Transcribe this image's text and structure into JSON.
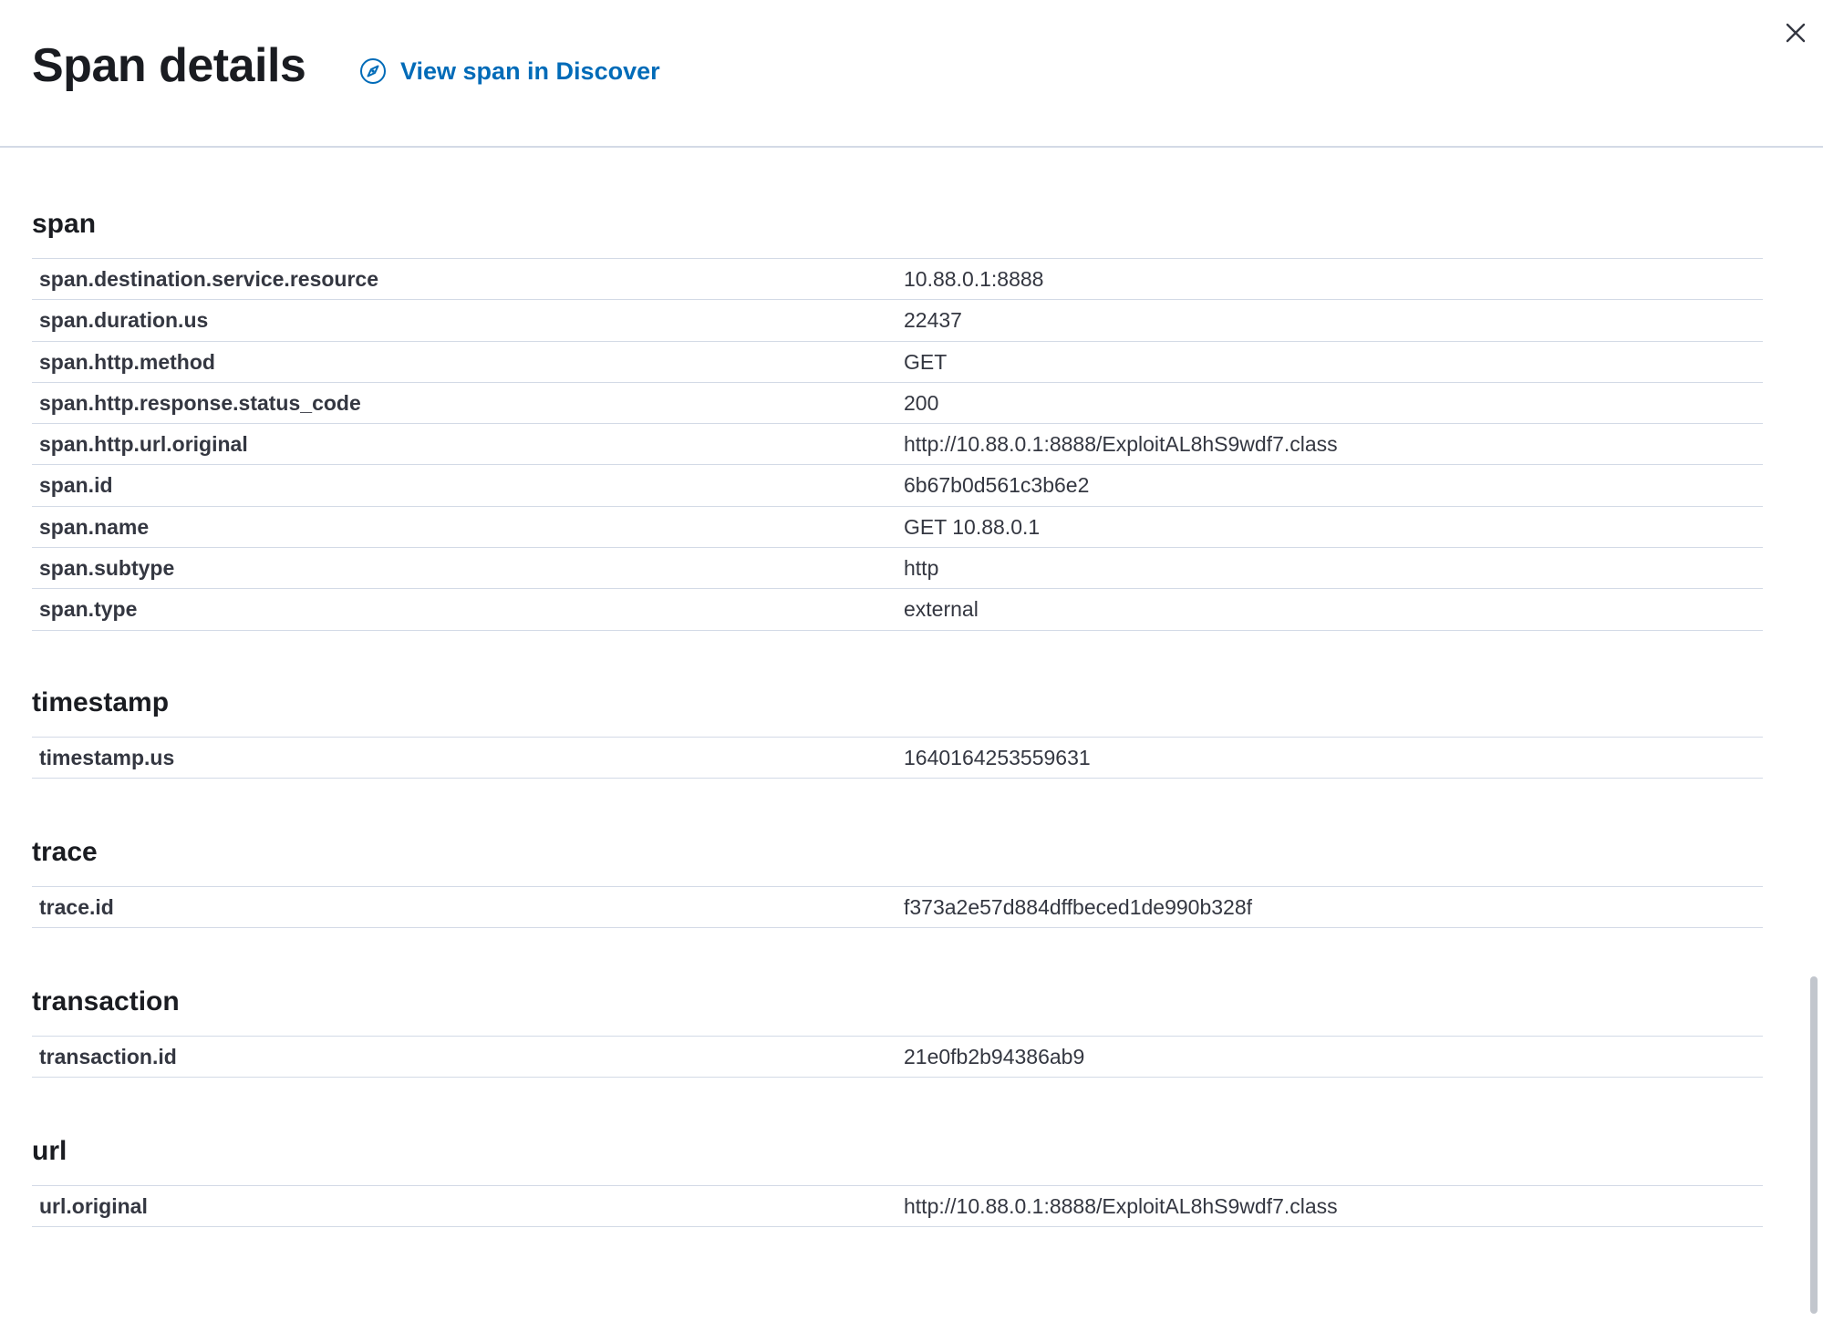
{
  "header": {
    "title": "Span details",
    "discover_link_label": "View span in Discover"
  },
  "sections": [
    {
      "title": "span",
      "rows": [
        {
          "key": "span.destination.service.resource",
          "value": "10.88.0.1:8888"
        },
        {
          "key": "span.duration.us",
          "value": "22437"
        },
        {
          "key": "span.http.method",
          "value": "GET"
        },
        {
          "key": "span.http.response.status_code",
          "value": "200"
        },
        {
          "key": "span.http.url.original",
          "value": "http://10.88.0.1:8888/ExploitAL8hS9wdf7.class"
        },
        {
          "key": "span.id",
          "value": "6b67b0d561c3b6e2"
        },
        {
          "key": "span.name",
          "value": "GET 10.88.0.1"
        },
        {
          "key": "span.subtype",
          "value": "http"
        },
        {
          "key": "span.type",
          "value": "external"
        }
      ]
    },
    {
      "title": "timestamp",
      "rows": [
        {
          "key": "timestamp.us",
          "value": "1640164253559631"
        }
      ]
    },
    {
      "title": "trace",
      "rows": [
        {
          "key": "trace.id",
          "value": "f373a2e57d884dffbeced1de990b328f"
        }
      ]
    },
    {
      "title": "transaction",
      "rows": [
        {
          "key": "transaction.id",
          "value": "21e0fb2b94386ab9"
        }
      ]
    },
    {
      "title": "url",
      "rows": [
        {
          "key": "url.original",
          "value": "http://10.88.0.1:8888/ExploitAL8hS9wdf7.class"
        }
      ]
    }
  ],
  "colors": {
    "link": "#006bb8",
    "text": "#1a1c21",
    "border": "#d3dae6"
  }
}
